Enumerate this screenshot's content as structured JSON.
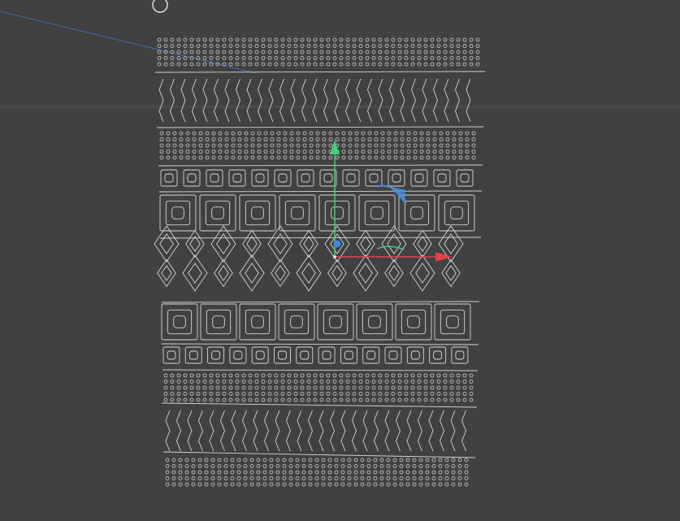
{
  "viewport": {
    "name": "3d-viewport",
    "background_color": "#414141",
    "horizon_color": "#4a4a4a"
  },
  "object": {
    "name": "tribal-pattern-spline-object",
    "stroke_color": "#d6d6d6",
    "bands": [
      "dots",
      "zigzag",
      "dots",
      "small-squares",
      "large-squares",
      "diamonds",
      "large-squares",
      "small-squares",
      "dots",
      "zigzag",
      "dots"
    ]
  },
  "gizmo": {
    "x_axis_color": "#e8404a",
    "y_axis_color": "#3fd07a",
    "z_axis_color": "#3a86e8",
    "rotation_handle_color": "#4a90e0"
  },
  "camera_line_color": "#3f6fb0"
}
